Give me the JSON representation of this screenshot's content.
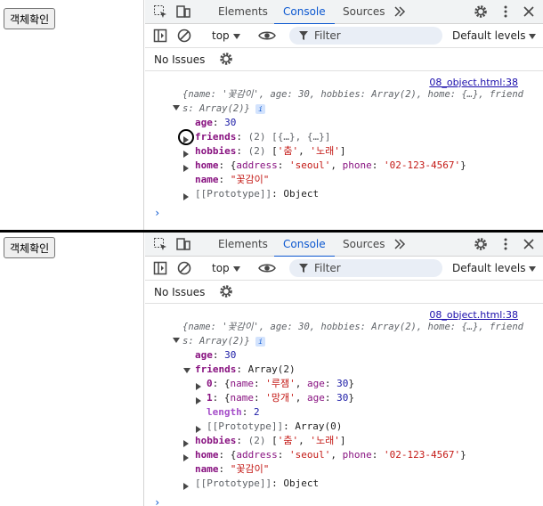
{
  "page": {
    "button_label": "객체확인"
  },
  "tabs": [
    "Elements",
    "Console",
    "Sources"
  ],
  "toolbar": {
    "context": "top",
    "filter_placeholder": "Filter",
    "levels": "Default levels"
  },
  "issues": "No Issues",
  "console": {
    "source_link": "08_object.html:38",
    "summary_1": "{name: '꽃감이', age: 30, hobbies: Array(2), home: {…}, friend",
    "summary_2": "s: Array(2)}",
    "age_key": "age",
    "age_val": "30",
    "friends_key": "friends",
    "friends_collapsed": "(2) [{…}, {…}]",
    "friends_expanded": "Array(2)",
    "friend0": {
      "index": "0",
      "name": "'루잼'",
      "age": "30"
    },
    "friend1": {
      "index": "1",
      "name": "'망개'",
      "age": "30"
    },
    "length_key": "length",
    "length_val": "2",
    "proto_key": "[[Prototype]]",
    "proto_array": "Array(0)",
    "proto_object": "Object",
    "hobbies_key": "hobbies",
    "hobbies_count": "(2)",
    "hobby1": "'춤'",
    "hobby2": "'노래'",
    "home_key": "home",
    "home_address": "'seoul'",
    "home_phone": "'02-123-4567'",
    "name_key": "name",
    "name_val": "\"꽃감이\"",
    "prompt": "›"
  },
  "colors": {
    "accent": "#0b57d0",
    "key": "#881280",
    "string": "#c41a16",
    "number": "#1a1aa6"
  }
}
